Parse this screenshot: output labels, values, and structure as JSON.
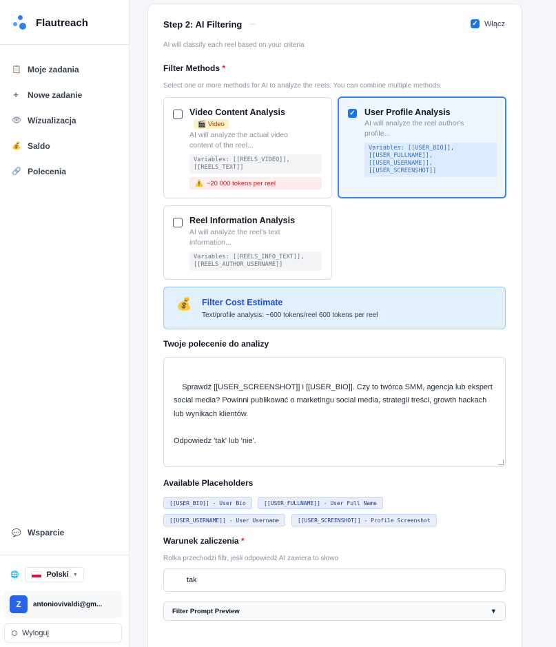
{
  "app": {
    "name": "Flautreach"
  },
  "sidebar": {
    "items": [
      {
        "label": "Moje zadania",
        "icon": "clipboard-icon"
      },
      {
        "label": "Nowe zadanie",
        "icon": "plus-icon"
      },
      {
        "label": "Wizualizacja",
        "icon": "eye-icon"
      },
      {
        "label": "Saldo",
        "icon": "money-bag-icon"
      },
      {
        "label": "Polecenia",
        "icon": "link-icon"
      }
    ],
    "support": "Wsparcie",
    "language": "Polski",
    "user_initial": "Z",
    "user_email": "antoniovivaldi@gm...",
    "logout": "Wyloguj"
  },
  "step": {
    "title": "Step 2: AI Filtering",
    "enable_label": "Włącz",
    "enabled": true,
    "subtitle": "AI will classify each reel based on your criteria"
  },
  "filter_methods": {
    "label": "Filter Methods",
    "required_mark": "*",
    "hint": "Select one or more methods for AI to analyze the reels. You can combine multiple methods.",
    "methods": [
      {
        "title": "Video Content Analysis",
        "badge": "Video",
        "desc1": "AI will analyze the actual video",
        "desc2": "content of the reel...",
        "vars1": "Variables: [[REELS_VIDEO]],",
        "vars2": "[[REELS_TEXT]]",
        "warning": "~20 000 tokens per reel",
        "checked": false
      },
      {
        "title": "User Profile Analysis",
        "desc1": "AI will analyze the reel author's",
        "desc2": "profile...",
        "vars1": "Variables: [[USER_BIO]],",
        "vars2": "[[USER_FULLNAME]],",
        "vars3": "[[USER_USERNAME]],",
        "vars4": "[[USER_SCREENSHOT]]",
        "checked": true
      },
      {
        "title": "Reel Information Analysis",
        "desc1": "AI will analyze the reel's text",
        "desc2": "information...",
        "vars1": "Variables: [[REELS_INFO_TEXT]],",
        "vars2": "[[REELS_AUTHOR_USERNAME]]",
        "checked": false
      }
    ]
  },
  "estimate": {
    "title": "Filter Cost Estimate",
    "text": "Text/profile analysis: ~600 tokens/reel 600 tokens per reel"
  },
  "prompt": {
    "label": "Twoje polecenie do analizy",
    "value": "Sprawdź [[USER_SCREENSHOT]] i [[USER_BIO]]. Czy to twórca SMM, agencja lub ekspert social media? Powinni publikować o marketingu social media, strategii treści, growth hackach lub wynikach klientów.\n\nOdpowiedz 'tak' lub 'nie'."
  },
  "placeholders": {
    "label": "Available Placeholders",
    "items": [
      "[[USER_BIO]] - User Bio",
      "[[USER_FULLNAME]] - User Full Name",
      "[[USER_USERNAME]] - User Username",
      "[[USER_SCREENSHOT]] - Profile Screenshot"
    ]
  },
  "condition": {
    "label": "Warunek zaliczenia",
    "required_mark": "*",
    "hint": "Rolka przechodzi filtr, jeśli odpowiedź AI zawiera to słowo",
    "value": "tak"
  },
  "preview": {
    "label": "Filter Prompt Preview",
    "toggle": "▼"
  },
  "colors": {
    "accent": "#1a73e8",
    "brand": "#2f80ed",
    "warning": "#b91c1c"
  }
}
